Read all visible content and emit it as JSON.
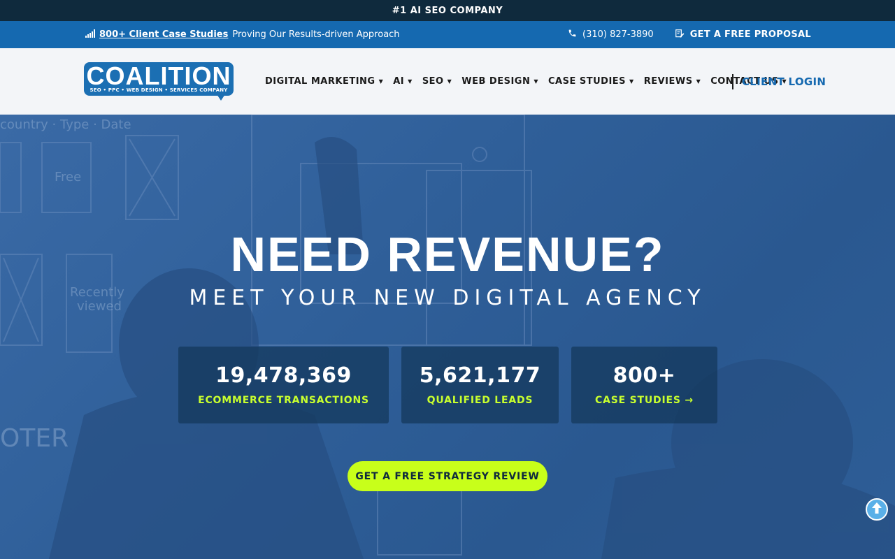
{
  "topbar": {
    "text": "#1 AI SEO COMPANY"
  },
  "bluebar": {
    "case_link": "800+ Client Case Studies",
    "case_rest": "Proving Our Results-driven Approach",
    "phone": "(310) 827-3890",
    "proposal": "GET A FREE PROPOSAL"
  },
  "logo": {
    "word": "COALITION",
    "tag": "SEO • PPC • WEB DESIGN • SERVICES COMPANY"
  },
  "nav": {
    "items": [
      {
        "label": "DIGITAL MARKETING"
      },
      {
        "label": "AI"
      },
      {
        "label": "SEO"
      },
      {
        "label": "WEB DESIGN"
      },
      {
        "label": "CASE STUDIES"
      },
      {
        "label": "REVIEWS"
      },
      {
        "label": "CONTACT US"
      }
    ],
    "client_login": "CLIENT LOGIN"
  },
  "hero": {
    "headline": "NEED REVENUE?",
    "subline": "MEET YOUR NEW DIGITAL AGENCY",
    "stats": [
      {
        "number": "19,478,369",
        "label": "ECOMMERCE TRANSACTIONS"
      },
      {
        "number": "5,621,177",
        "label": "QUALIFIED LEADS"
      },
      {
        "number": "800+",
        "label": "CASE STUDIES →"
      }
    ],
    "cta": "GET A FREE STRATEGY REVIEW"
  },
  "colors": {
    "accent_green": "#c8ff1a",
    "brand_blue": "#1569b0",
    "dark_navy": "#0f2a3d"
  },
  "icons": [
    "signal-bars-icon",
    "phone-icon",
    "proposal-edit-icon",
    "caret-down-icon",
    "arrow-up-icon"
  ]
}
